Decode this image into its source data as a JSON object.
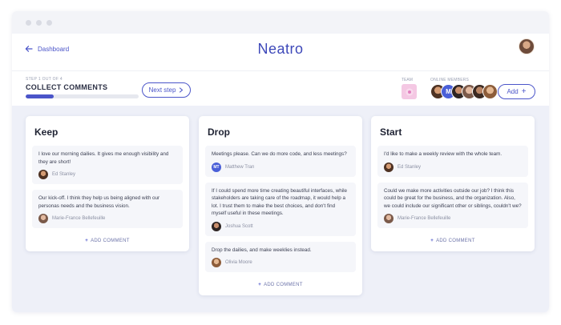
{
  "app": {
    "brand": "Neatro",
    "back_label": "Dashboard"
  },
  "step": {
    "counter": "STEP 1 OUT OF 4",
    "title": "COLLECT COMMENTS",
    "progress_fraction": 0.25,
    "next_label": "Next step"
  },
  "team": {
    "label": "TEAM"
  },
  "online": {
    "label": "ONLINE MEMBERS",
    "initial_member": "M"
  },
  "add_label": "Add",
  "colors": {
    "accent": "#4b55c9",
    "board_bg": "#eef0f8",
    "card_bg": "#f5f6fa"
  },
  "columns": [
    {
      "title": "Keep",
      "add_comment": "ADD COMMENT",
      "cards": [
        {
          "text": "I love our morning dailies. It gives me enough visibility and they are short!",
          "author": "Ed Stanley"
        },
        {
          "text": "Our kick-off. I think they help us being aligned with our personas needs and the business vision.",
          "author": "Marie-France Bellefeuille"
        }
      ]
    },
    {
      "title": "Drop",
      "add_comment": "ADD COMMENT",
      "cards": [
        {
          "text": "Meetings please. Can we do more code, and less meetings?",
          "author": "Matthew Tran",
          "initials": "MT"
        },
        {
          "text": "If I could spend more time creating beautiful interfaces, while stakeholders are taking care of the roadmap, it would help a lot. I trust them to make the best choices, and don't find myself useful in these meetings.",
          "author": "Joshua Scott"
        },
        {
          "text": "Drop the dailies, and make weeklies instead.",
          "author": "Olivia Moore"
        }
      ]
    },
    {
      "title": "Start",
      "add_comment": "ADD COMMENT",
      "cards": [
        {
          "text": "I'd like to make a weekly review with the whole team.",
          "author": "Ed Stanley"
        },
        {
          "text": "Could we make more activities outside our job? I think this could be great for the business, and the organization. Also, we could include our significant other or siblings, couldn't we?",
          "author": "Marie-France Bellefeuille"
        }
      ]
    }
  ]
}
